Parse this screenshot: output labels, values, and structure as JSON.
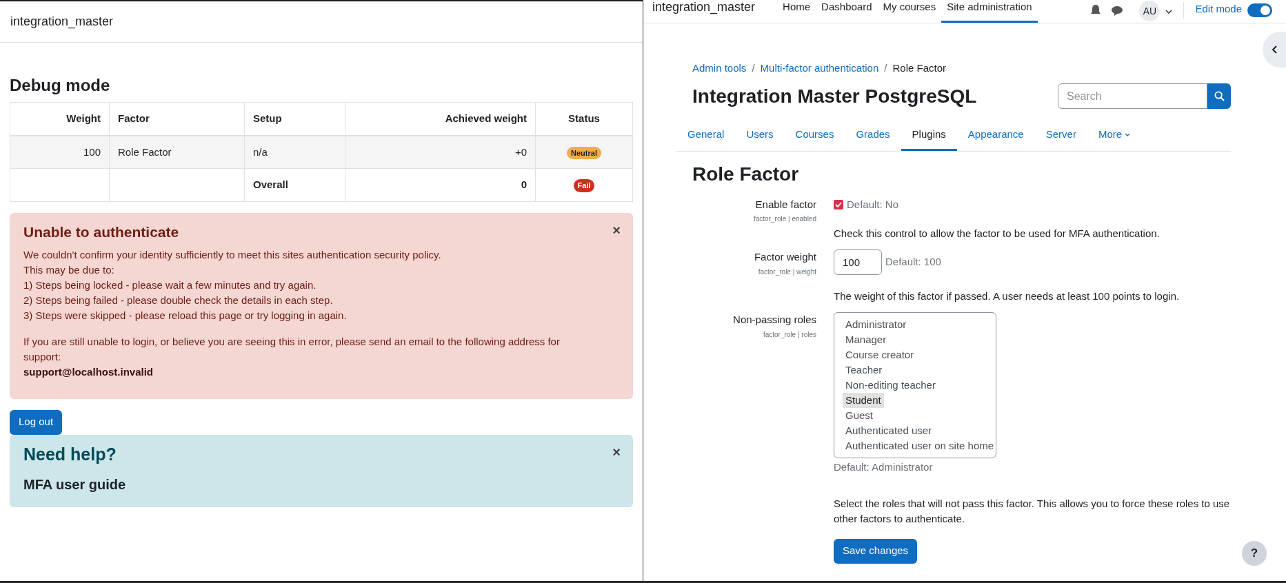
{
  "left_window": {
    "site_name": "integration_master",
    "heading": "Debug mode",
    "table": {
      "columns": [
        "Weight",
        "Factor",
        "Setup",
        "Achieved weight",
        "Status"
      ],
      "rows": [
        {
          "kind": "factor",
          "cells": [
            "100",
            "Role Factor",
            "n/a",
            "+0"
          ],
          "status": {
            "label": "Neutral",
            "color": "#f0ad4e"
          }
        },
        {
          "kind": "total",
          "cells": [
            "",
            "",
            "Overall",
            "0"
          ],
          "status": {
            "label": "Fail",
            "color": "#ca3120"
          }
        }
      ]
    },
    "error_alert": {
      "title": "Unable to authenticate",
      "close": "×",
      "lines": [
        "We couldn't confirm your identity sufficiently to meet this sites authentication security policy.",
        "This may be due to:",
        "1) Steps being locked - please wait a few minutes and try again.",
        "2) Steps being failed - please double check the details in each step.",
        "3) Steps were skipped - please reload this page or try logging in again."
      ],
      "support_text": "If you are still unable to login, or believe you are seeing this in error, please send an email to the following address for support:",
      "email": "support@localhost.invalid"
    },
    "logout_button": "Log out",
    "help_alert": {
      "title": "Need help?",
      "close": "×",
      "link": "MFA user guide"
    }
  },
  "right_window": {
    "site_name": "integration_master",
    "nav": [
      {
        "label": "Home",
        "selected": false
      },
      {
        "label": "Dashboard",
        "selected": false
      },
      {
        "label": "My courses",
        "selected": false
      },
      {
        "label": "Site administration",
        "selected": true
      }
    ],
    "user_initials": "AU",
    "edit_mode": {
      "label": "Edit mode",
      "on": true
    },
    "breadcrumb": [
      {
        "label": "Admin tools",
        "current": false
      },
      {
        "separator": "/"
      },
      {
        "label": "Multi-factor authentication",
        "current": false
      },
      {
        "separator": "/"
      },
      {
        "label": "Role Factor",
        "current": true
      }
    ],
    "title": "Integration Master PostgreSQL",
    "search": {
      "placeholder": "Search"
    },
    "tabs": [
      {
        "label": "General",
        "selected": false
      },
      {
        "label": "Users",
        "selected": false
      },
      {
        "label": "Courses",
        "selected": false
      },
      {
        "label": "Grades",
        "selected": false
      },
      {
        "label": "Plugins",
        "selected": true
      },
      {
        "label": "Appearance",
        "selected": false
      },
      {
        "label": "Server",
        "selected": false
      },
      {
        "label": "More",
        "selected": false
      }
    ],
    "section_title": "Role Factor",
    "settings": [
      {
        "kind": "checkbox",
        "label": "Enable factor",
        "key": "factor_role | enabled",
        "checked": true,
        "default": "Default: No",
        "description": "Check this control to allow the factor to be used for MFA authentication."
      },
      {
        "kind": "text",
        "label": "Factor weight",
        "key": "factor_role | weight",
        "value": "100",
        "default": "Default: 100",
        "description": "The weight of this factor if passed. A user needs at least 100 points to login."
      },
      {
        "kind": "multiselect",
        "label": "Non-passing roles",
        "key": "factor_role | roles",
        "options": [
          {
            "label": "Administrator",
            "selected": false
          },
          {
            "label": "Manager",
            "selected": false
          },
          {
            "label": "Course creator",
            "selected": false
          },
          {
            "label": "Teacher",
            "selected": false
          },
          {
            "label": "Non-editing teacher",
            "selected": false
          },
          {
            "label": "Student",
            "selected": true
          },
          {
            "label": "Guest",
            "selected": false
          },
          {
            "label": "Authenticated user",
            "selected": false
          },
          {
            "label": "Authenticated user on site home",
            "selected": false
          }
        ],
        "default": "Default: Administrator",
        "description": "Select the roles that will not pass this factor. This allows you to force these roles to use other factors to authenticate."
      }
    ],
    "save_button": "Save changes",
    "help_button": "?"
  }
}
